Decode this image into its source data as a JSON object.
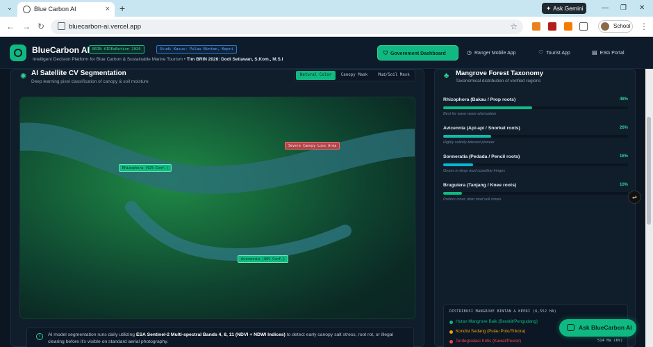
{
  "browser": {
    "tab_title": "Blue Carbon AI",
    "url": "bluecarbon-ai.vercel.app",
    "gemini_label": "Ask Gemini",
    "profile_label": "School",
    "colors": {
      "tabbar": "#c8e6f2"
    }
  },
  "header": {
    "brand": "BlueCarbon AI",
    "badge_event": "BRIN AIDEaNation 2026",
    "badge_case": "Studi Kasus: Pulau Bintan, Kepri",
    "subtitle": "Intelligent Decision Platform for Blue Carbon & Sustainable Marine Tourism •",
    "team": "Tim BRIN 2026: Dodi Setiawan, S.Kom., M.S.I",
    "nav": [
      {
        "label": "Government Dashboard",
        "icon": "shield-icon",
        "active": true
      },
      {
        "label": "Ranger Mobile App",
        "icon": "clock-icon",
        "active": false
      },
      {
        "label": "Tourist App",
        "icon": "heart-icon",
        "active": false
      },
      {
        "label": "ESG Portal",
        "icon": "document-icon",
        "active": false
      }
    ],
    "colors": {
      "accent": "#10b981"
    }
  },
  "cv_panel": {
    "title": "AI Satellite CV Segmentation",
    "subtitle": "Deep learning pixel classification of canopy & soil moisture",
    "modes": [
      "Natural Color",
      "Canopy Mask",
      "Mud/Soil Mask"
    ],
    "active_mode": "Natural Color",
    "labels": {
      "rhizophora": "Rhizophora (92% Conf.)",
      "stress": "Severe Canopy Loss Area",
      "avicennia": "Avicennia (86% Conf.)"
    },
    "note_prefix": "AI model segmentation runs daily utilizing",
    "note_bold": "ESA Sentinel-2 Multi-spectral Bands 4, 8, 11 (NDVI + NDWI Indices)",
    "note_suffix": "to detect early canopy salt stress, root rot, or illegal clearing before it's visible on standard aerial photography."
  },
  "taxonomy": {
    "title": "Mangrove Forest Taxonomy",
    "subtitle": "Taxonomical distribution of verified regions",
    "species": [
      {
        "name": "Rhizophora (Bakau / Prop roots)",
        "percent": 48,
        "percent_label": "48%",
        "desc": "Best for wave wave attenuation",
        "color": "#10b981"
      },
      {
        "name": "Avicennia (Api-api / Snorkel roots)",
        "percent": 26,
        "percent_label": "26%",
        "desc": "Highly salinity-tolerant pioneer",
        "color": "#14b8a6"
      },
      {
        "name": "Sonneratia (Pedada / Pencil roots)",
        "percent": 16,
        "percent_label": "16%",
        "desc": "Grows in deep mud coastline fringes",
        "color": "#06b6d4"
      },
      {
        "name": "Bruguiera (Tanjang / Knee roots)",
        "percent": 10,
        "percent_label": "10%",
        "desc": "Prefers inner, drier mud soil zones",
        "color": "#10b981"
      }
    ],
    "distribution": {
      "title": "DISTRIBUSI MANGROVE BINTAN & KEPRI (6,552 HA)",
      "items": [
        {
          "label": "Hutan Mangrove Baik (Berakit/Pengudang)",
          "value": "",
          "color": "#10b981"
        },
        {
          "label": "Kondisi Sedang (Pulau Poto/Trikora)",
          "value": "",
          "color": "#f59e0b"
        },
        {
          "label": "Terdegradasi Kritis (Kawal/Pesisir)",
          "value": "514 Ha (6%)",
          "color": "#ef4444"
        }
      ]
    }
  },
  "assistant": {
    "label": "Ask BlueCarbon AI"
  }
}
